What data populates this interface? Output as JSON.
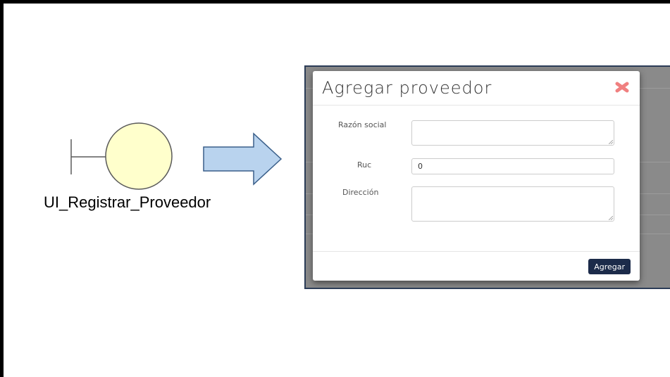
{
  "boundary": {
    "label": "UI_Registrar_Proveedor",
    "fill_color": "#ffffcc",
    "stroke_color": "#5a5a5a"
  },
  "arrow": {
    "fill_color": "#b9d3ee",
    "stroke_color": "#3a5f8a",
    "direction": "right"
  },
  "modal": {
    "title": "Agregar proveedor",
    "close_icon": "close-x-icon",
    "close_color": "#f08080",
    "fields": [
      {
        "label": "Razón social",
        "value": "",
        "type": "textarea"
      },
      {
        "label": "Ruc",
        "value": "0",
        "type": "input"
      },
      {
        "label": "Dirección",
        "value": "",
        "type": "textarea"
      }
    ],
    "submit_label": "Agregar",
    "submit_color": "#1c2b4a"
  }
}
